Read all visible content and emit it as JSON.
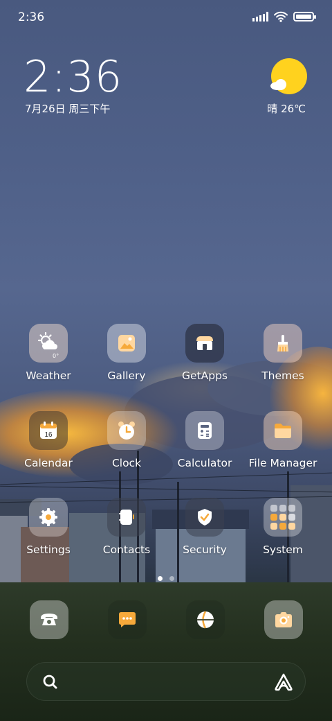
{
  "status_bar": {
    "time": "2:36",
    "battery_level": 1.0
  },
  "clock_widget": {
    "time": "2:36",
    "date": "7月26日 周三下午"
  },
  "weather_widget": {
    "condition_icon": "sun-cloud-icon",
    "text": "晴 26℃"
  },
  "apps": [
    {
      "label": "Weather",
      "icon": "weather-icon"
    },
    {
      "label": "Gallery",
      "icon": "gallery-icon"
    },
    {
      "label": "GetApps",
      "icon": "getapps-icon"
    },
    {
      "label": "Themes",
      "icon": "themes-icon"
    },
    {
      "label": "Calendar",
      "icon": "calendar-icon",
      "icon_text": "16"
    },
    {
      "label": "Clock",
      "icon": "clock-icon"
    },
    {
      "label": "Calculator",
      "icon": "calculator-icon"
    },
    {
      "label": "File Manager",
      "icon": "file-manager-icon"
    },
    {
      "label": "Settings",
      "icon": "settings-icon"
    },
    {
      "label": "Contacts",
      "icon": "contacts-icon"
    },
    {
      "label": "Security",
      "icon": "security-icon"
    },
    {
      "label": "System",
      "icon": "system-folder-icon"
    }
  ],
  "weather_app_badge": "0°",
  "page_indicator": {
    "pages": 2,
    "current": 1
  },
  "dock": [
    {
      "name": "phone",
      "icon": "phone-icon"
    },
    {
      "name": "messages",
      "icon": "messages-icon"
    },
    {
      "name": "browser",
      "icon": "browser-icon"
    },
    {
      "name": "camera",
      "icon": "camera-icon"
    }
  ],
  "search_bar": {
    "left_icon": "search-icon",
    "right_icon": "assistant-icon"
  },
  "colors": {
    "accent_yellow": "#ffd21e",
    "icon_peach": "#ffd7a0",
    "icon_orange": "#f6a93b"
  }
}
